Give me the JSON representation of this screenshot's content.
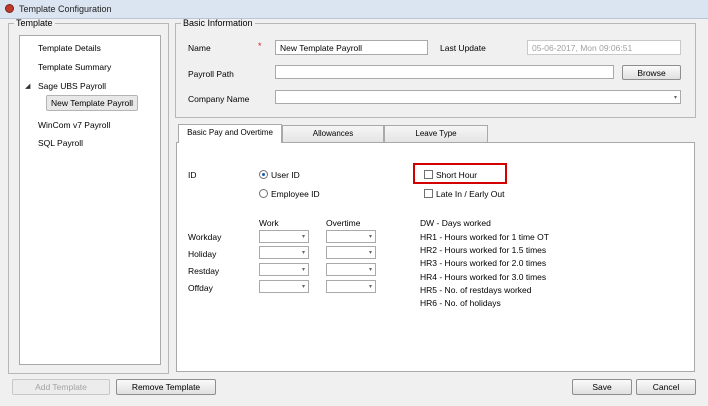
{
  "window": {
    "title": "Template Configuration"
  },
  "template_group": {
    "legend": "Template",
    "tree": [
      {
        "label": "Template Details"
      },
      {
        "label": "Template Summary"
      },
      {
        "label": "Sage UBS Payroll",
        "expander": "◢"
      },
      {
        "label": "New Template Payroll",
        "selected": true
      },
      {
        "label": "WinCom v7 Payroll"
      },
      {
        "label": "SQL Payroll"
      }
    ]
  },
  "basic_info": {
    "legend": "Basic Information",
    "name_label": "Name",
    "required_mark": "*",
    "name_value": "New Template Payroll",
    "last_update_label": "Last Update",
    "last_update_value": "05-06-2017, Mon  09:06:51",
    "payroll_path_label": "Payroll Path",
    "payroll_path_value": "",
    "browse_label": "Browse",
    "company_name_label": "Company Name",
    "company_name_value": ""
  },
  "tabs": [
    {
      "label": "Basic Pay and Overtime",
      "active": true
    },
    {
      "label": "Allowances"
    },
    {
      "label": "Leave Type"
    }
  ],
  "basic_pay": {
    "id_label": "ID",
    "user_id_label": "User ID",
    "employee_id_label": "Employee ID",
    "id_selected": "User ID",
    "short_hour_label": "Short Hour",
    "late_in_label": "Late In / Early Out",
    "work_header": "Work",
    "overtime_header": "Overtime",
    "rows": [
      "Workday",
      "Holiday",
      "Restday",
      "Offday"
    ],
    "legend_lines": [
      "DW - Days worked",
      "HR1 - Hours worked for 1 time OT",
      "HR2 - Hours worked for 1.5 times",
      "HR3 - Hours worked for 2.0 times",
      "HR4 - Hours worked for 3.0 times",
      "HR5 - No. of restdays worked",
      "HR6 - No. of holidays"
    ]
  },
  "footer": {
    "add_template": "Add Template",
    "remove_template": "Remove Template",
    "save": "Save",
    "cancel": "Cancel"
  },
  "icons": {
    "combo_arrow": "▾"
  },
  "colors": {
    "highlight": "#d40000",
    "radio_dot": "#1e5aa8",
    "titlebar": "#dbe4f1"
  }
}
